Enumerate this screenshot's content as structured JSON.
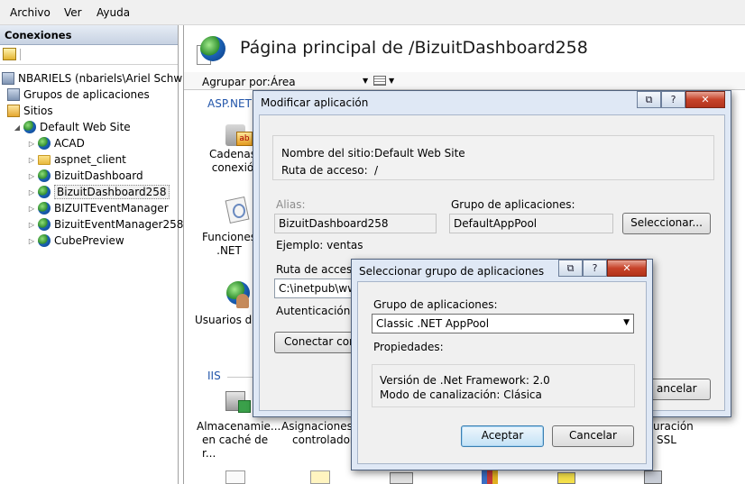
{
  "menu": {
    "items": [
      "Archivo",
      "Ver",
      "Ayuda"
    ]
  },
  "connections": {
    "header": "Conexiones",
    "tree": {
      "server": "NBARIELS (nbariels\\Ariel Schwindt)",
      "app_pools": "Grupos de aplicaciones",
      "sites": "Sitios",
      "default_site": "Default Web Site",
      "children": [
        "ACAD",
        "aspnet_client",
        "BizuitDashboard",
        "BizuitDashboard258",
        "BIZUITEventManager",
        "BizuitEventManager258",
        "CubePreview"
      ],
      "selected": "BizuitDashboard258"
    }
  },
  "main": {
    "title": "Página principal de /BizuitDashboard258",
    "group_by_label": "Agrupar por:",
    "group_by_value": "Área",
    "section_aspnet": "ASP.NET",
    "section_iis": "IIS",
    "features": {
      "conn_strings_1": "Cadenas",
      "conn_strings_2": "conexió",
      "net_functions_1": "Funciones",
      "net_functions_2": ".NET",
      "users_1": "Usuarios de",
      "cache_1": "Almacenamie...",
      "cache_2": "en caché de r...",
      "handler_1": "Asignaciones",
      "handler_2": "controlador",
      "ssl_1": "uración",
      "ssl_2": "SSL"
    }
  },
  "edit_app_dialog": {
    "title": "Modificar aplicación",
    "site_name_label": "Nombre del sitio:",
    "site_name_value": "Default Web Site",
    "path_label": "Ruta de acceso:",
    "path_value": "/",
    "alias_label": "Alias:",
    "alias_value": "BizuitDashboard258",
    "app_pool_label": "Grupo de aplicaciones:",
    "app_pool_value": "DefaultAppPool",
    "select_button": "Seleccionar...",
    "example": "Ejemplo: ventas",
    "physical_path_label": "Ruta de acceso",
    "physical_path_value": "C:\\inetpub\\www",
    "auth_label": "Autenticación d",
    "connect_as_button": "Conectar com",
    "cancel_button_partial": "ancelar"
  },
  "select_pool_dialog": {
    "title": "Seleccionar grupo de aplicaciones",
    "pool_label": "Grupo de aplicaciones:",
    "pool_selected": "Classic .NET AppPool",
    "properties_label": "Propiedades:",
    "framework_version": "Versión de .Net Framework: 2.0",
    "pipeline_mode": "Modo de canalización: Clásica",
    "ok_button": "Aceptar",
    "cancel_button": "Cancelar"
  },
  "caption_buttons": {
    "restore": "⧉",
    "help": "?",
    "close": "✕"
  },
  "colors": {
    "link_blue": "#2255aa",
    "dialog_frame": "#dfe8f5"
  }
}
